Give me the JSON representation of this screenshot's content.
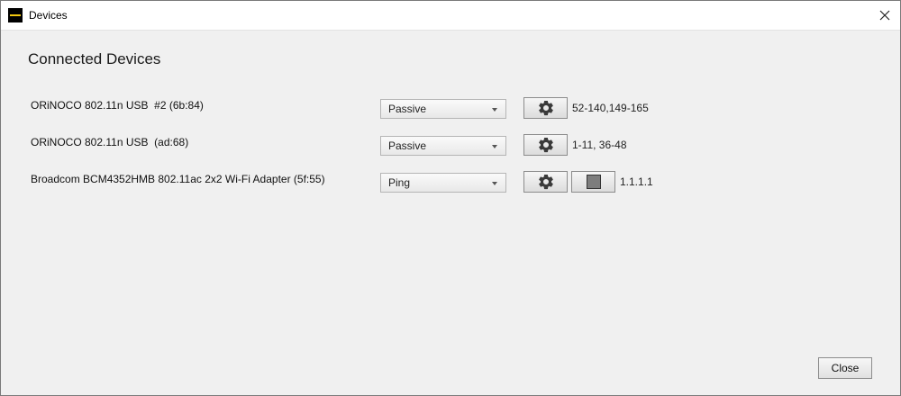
{
  "window": {
    "title": "Devices"
  },
  "heading": "Connected Devices",
  "devices": [
    {
      "name": "ORiNOCO 802.11n USB  #2 (6b:84)",
      "mode": "Passive",
      "channels": "52-140,149-165"
    },
    {
      "name": "ORiNOCO 802.11n USB  (ad:68)",
      "mode": "Passive",
      "channels": "1-11, 36-48"
    },
    {
      "name": "Broadcom BCM4352HMB 802.11ac 2x2 Wi-Fi Adapter (5f:55)",
      "mode": "Ping",
      "channels": "1.1.1.1"
    }
  ],
  "footer": {
    "close_label": "Close"
  },
  "icons": {
    "settings": "gear-icon",
    "stop": "stop-icon",
    "dropdown": "chevron-down-icon",
    "window_close": "close-icon"
  },
  "colors": {
    "app_icon_bg": "#000000",
    "app_icon_bar": "#f2c811",
    "dialog_bg": "#f0f0f0"
  }
}
